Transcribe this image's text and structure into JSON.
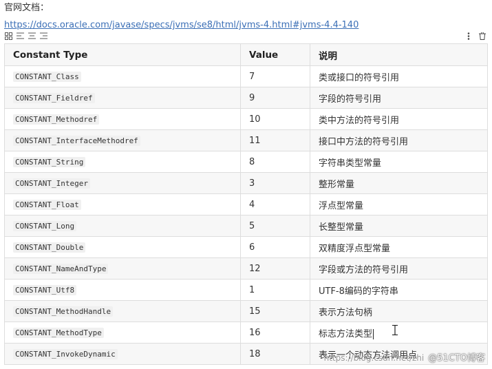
{
  "intro_text": "官网文档：",
  "link_text": "https://docs.oracle.com/javase/specs/jvms/se8/html/jvms-4.html#jvms-4.4-140",
  "toolbar": {
    "left_icons": [
      "table-grid-icon",
      "align-left-icon",
      "align-center-icon",
      "align-right-icon"
    ],
    "right_icons": [
      "more-vertical-icon",
      "trash-icon"
    ]
  },
  "table": {
    "headers": [
      "Constant Type",
      "Value",
      "说明"
    ],
    "rows": [
      {
        "type": "CONSTANT_Class",
        "value": "7",
        "desc": "类或接口的符号引用"
      },
      {
        "type": "CONSTANT_Fieldref",
        "value": "9",
        "desc": "字段的符号引用"
      },
      {
        "type": "CONSTANT_Methodref",
        "value": "10",
        "desc": "类中方法的符号引用"
      },
      {
        "type": "CONSTANT_InterfaceMethodref",
        "value": "11",
        "desc": "接口中方法的符号引用"
      },
      {
        "type": "CONSTANT_String",
        "value": "8",
        "desc": "字符串类型常量"
      },
      {
        "type": "CONSTANT_Integer",
        "value": "3",
        "desc": "整形常量"
      },
      {
        "type": "CONSTANT_Float",
        "value": "4",
        "desc": "浮点型常量"
      },
      {
        "type": "CONSTANT_Long",
        "value": "5",
        "desc": "长整型常量"
      },
      {
        "type": "CONSTANT_Double",
        "value": "6",
        "desc": "双精度浮点型常量"
      },
      {
        "type": "CONSTANT_NameAndType",
        "value": "12",
        "desc": "字段或方法的符号引用"
      },
      {
        "type": "CONSTANT_Utf8",
        "value": "1",
        "desc": "UTF-8编码的字符串"
      },
      {
        "type": "CONSTANT_MethodHandle",
        "value": "15",
        "desc": "表示方法句柄"
      },
      {
        "type": "CONSTANT_MethodType",
        "value": "16",
        "desc": "标志方法类型"
      },
      {
        "type": "CONSTANT_InvokeDynamic",
        "value": "18",
        "desc": "表示一个动态方法调用点"
      }
    ]
  },
  "watermark": {
    "url": "https://blog.csdn.net/zhi",
    "brand": "@51CTO博客"
  },
  "colors": {
    "link": "#3b6fb6",
    "header_bg": "#f7f7f7",
    "border": "#dddddd"
  }
}
